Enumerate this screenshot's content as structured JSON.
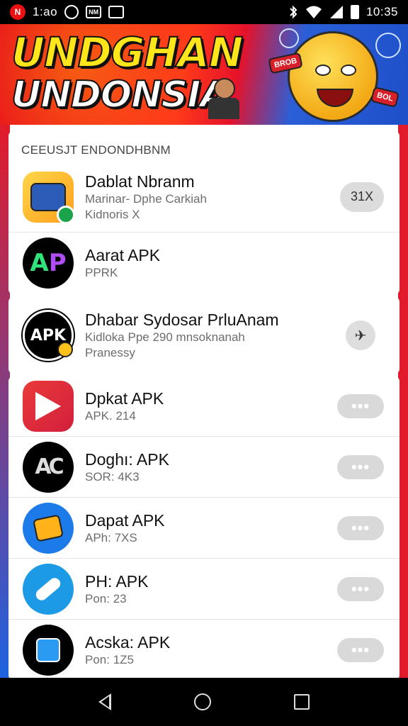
{
  "status_bar": {
    "left_text": "1:ao",
    "badge_label": "N",
    "box_label": "NM",
    "time": "10:35",
    "icons": [
      "notification-badge-icon",
      "circle-app-icon",
      "box-app-icon",
      "bag-app-icon",
      "bluetooth-icon",
      "wifi-icon",
      "signal-icon",
      "battery-icon"
    ]
  },
  "banner": {
    "line1": "UNDGHAN",
    "line2": "UNDONSIA",
    "sign1": "BROB",
    "sign2": "BOL"
  },
  "section1": {
    "header": "CEEUSJT ENDONDHBNM",
    "items": [
      {
        "name": "Dablat Nbranm",
        "sub1": "Marinar- Dphe Carkiah",
        "sub2": "Kidnoris X",
        "action": "31X",
        "icon": "game-character-icon"
      },
      {
        "name": "Aarat APK",
        "sub1": "PPRK",
        "icon": "ap-logo-icon"
      }
    ]
  },
  "section2": {
    "items": [
      {
        "name": "Dhabar Sydosar PrluAnam",
        "sub1": "Kidloka Ppe 290 mnsoknanah",
        "sub2": "Pranessy",
        "icon": "apk-badge-icon",
        "action_icon": "plane-icon"
      }
    ]
  },
  "section3": {
    "items": [
      {
        "name": "Dpkat APK",
        "sub1": "APK. 214",
        "icon": "play-store-icon",
        "action": "•••"
      },
      {
        "name": "Doghı: APK",
        "sub1": "SOR: 4K3",
        "icon": "ac-logo-icon",
        "action": "•••"
      },
      {
        "name": "Dapat APK",
        "sub1": "APh: 7XS",
        "icon": "blue-game-icon",
        "action": "•••"
      },
      {
        "name": "PH: APK",
        "sub1": "Pon: 23",
        "icon": "rocket-icon",
        "action": "•••"
      },
      {
        "name": "Acska: APK",
        "sub1": "Pon: 1Z5",
        "icon": "shopping-bag-icon",
        "action": "•••"
      }
    ]
  },
  "nav_bar": {
    "icons": [
      "back-icon",
      "home-icon",
      "recents-icon"
    ]
  }
}
